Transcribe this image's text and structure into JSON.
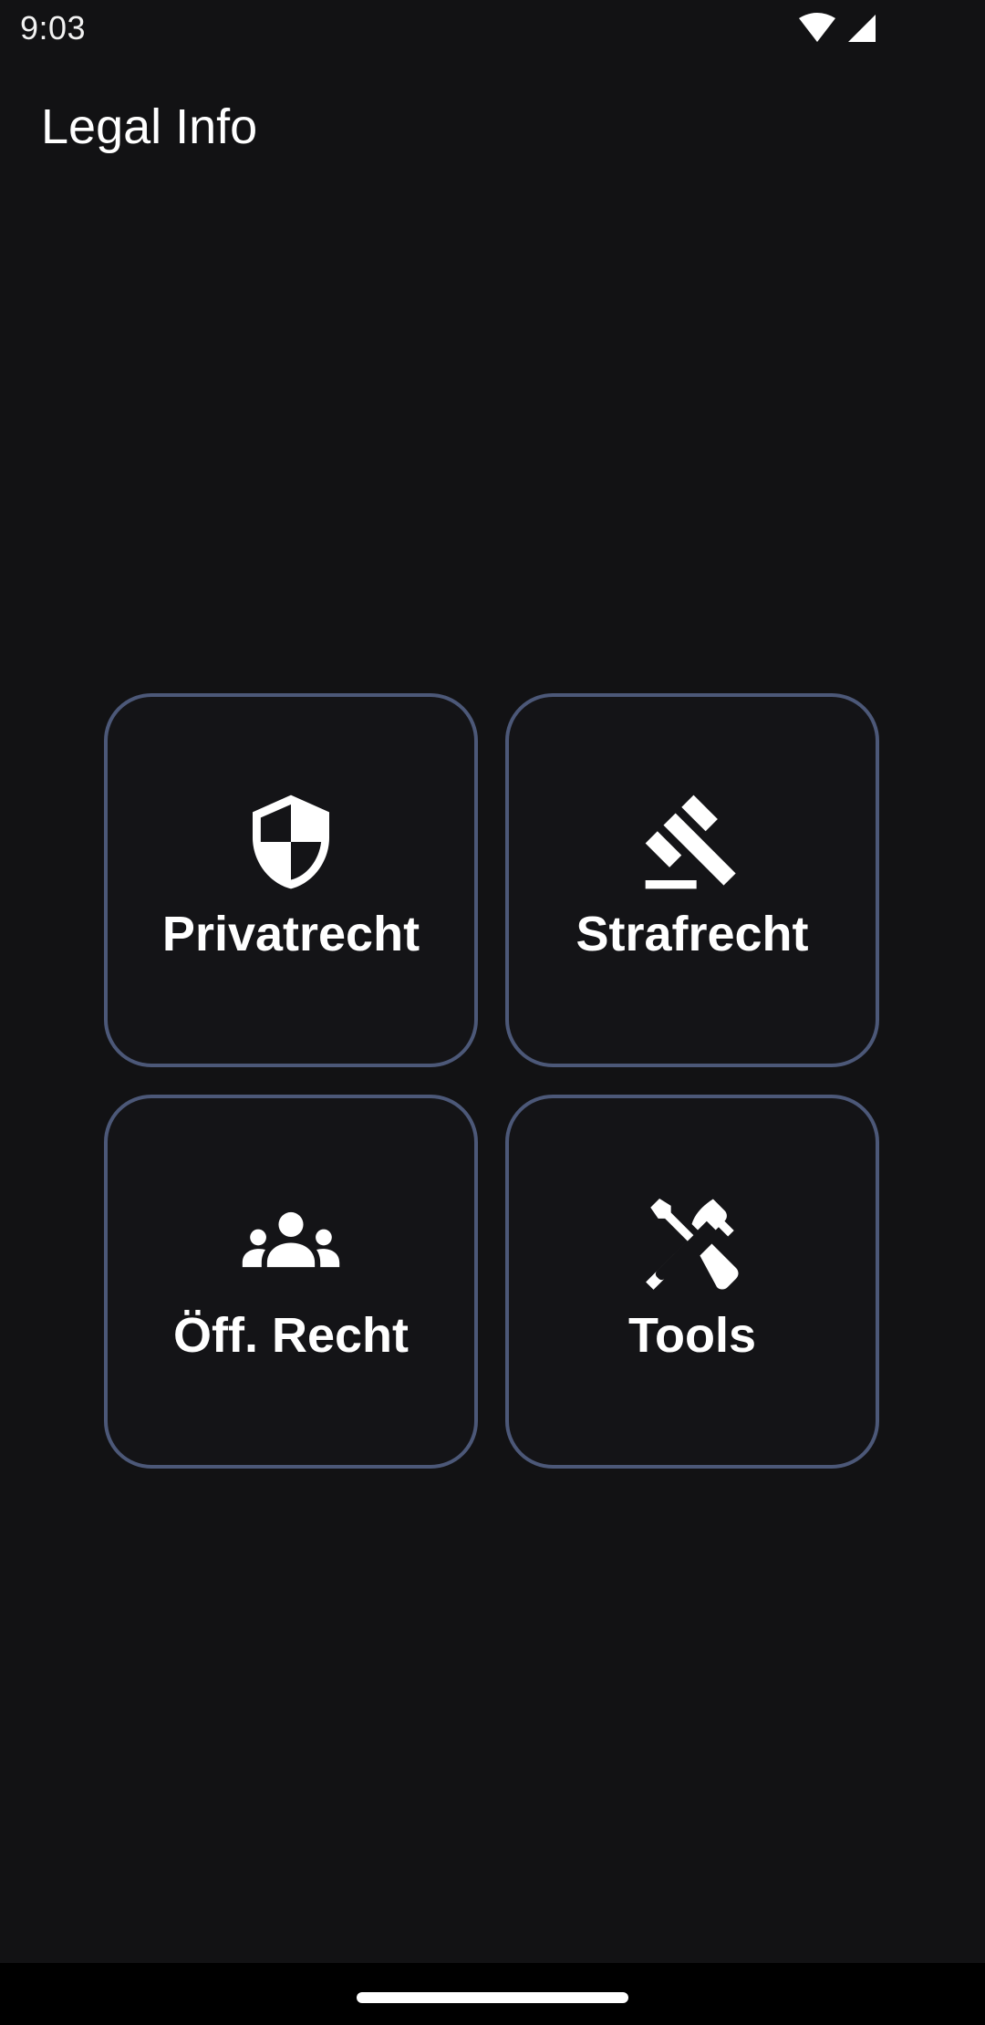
{
  "status_bar": {
    "time": "9:03",
    "icons": [
      "wifi-icon",
      "cellular-signal-icon"
    ]
  },
  "app_bar": {
    "title": "Legal Info"
  },
  "tiles": [
    {
      "label": "Privatrecht",
      "icon": "shield-icon"
    },
    {
      "label": "Strafrecht",
      "icon": "gavel-icon"
    },
    {
      "label": "Öff. Recht",
      "icon": "groups-icon"
    },
    {
      "label": "Tools",
      "icon": "tools-icon"
    }
  ],
  "colors": {
    "background": "#121214",
    "tile_border": "#4c5878",
    "text": "#ffffff"
  }
}
